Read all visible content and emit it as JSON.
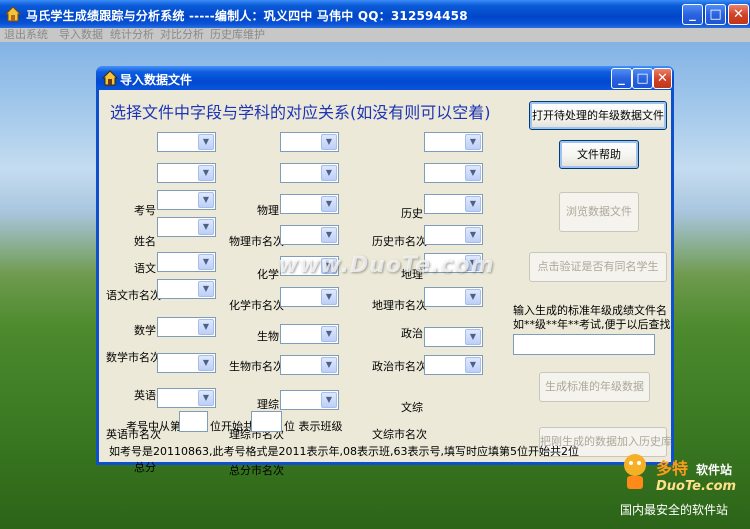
{
  "main_window": {
    "title": "马氏学生成绩跟踪与分析系统  -----编制人：巩义四中  马伟中       QQ：312594458",
    "menu": [
      "退出系统",
      "导入数据",
      "统计分析",
      "对比分析",
      "历史库维护"
    ]
  },
  "dialog": {
    "title": "导入数据文件",
    "heading": "选择文件中字段与学科的对应关系(如没有则可以空着)",
    "fields_col1": [
      "考号",
      "姓名",
      "语文",
      "语文市名次",
      "数学",
      "数学市名次",
      "英语",
      "英语市名次",
      "总分"
    ],
    "fields_col2": [
      "物理",
      "物理市名次",
      "化学",
      "化学市名次",
      "生物",
      "生物市名次",
      "理综",
      "理综市名次",
      "总分市名次"
    ],
    "fields_col3": [
      "历史",
      "历史市名次",
      "地理",
      "地理市名次",
      "政治",
      "政治市名次",
      "文综",
      "文综市名次"
    ],
    "buttons": {
      "open_file": "打开待处理的年级数据文件",
      "file_help": "文件帮助",
      "browse": "浏览数据文件",
      "verify": "点击验证是否有同名学生",
      "generate": "生成标准的年级数据",
      "add_history": "把刚生成的数据加入历史库"
    },
    "save_prompt_line1": "输入生成的标准年级成绩文件名",
    "save_prompt_line2": "如**级**年**考试,便于以后查找",
    "exam_number": {
      "prefix": "考号中从第",
      "middle": "位开始共",
      "suffix": "位  表示班级"
    },
    "example_note": "如考号是20110863,此考号格式是2011表示年,08表示班,63表示号,填写时应填第5位开始共2位"
  },
  "watermarks": {
    "center": "www.DuoTe.com",
    "logo_title": "多特",
    "logo_sub": "软件站",
    "logo_url": "DuoTe.com",
    "logo_slogan": "国内最安全的软件站"
  },
  "colors": {
    "titlebar": "#0a52d6",
    "dialog_bg": "#ece9d8",
    "heading": "#1c34b5"
  }
}
